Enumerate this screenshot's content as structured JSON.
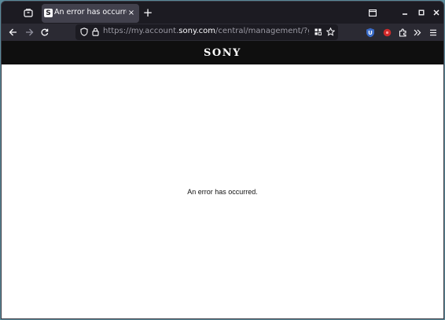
{
  "browser": {
    "tab": {
      "favicon": "S",
      "title": "An error has occurred."
    },
    "urlbar": {
      "scheme_prefix": "https://my.account.",
      "host": "sony.com",
      "path": "/central/management/?gated=t"
    }
  },
  "page": {
    "header": {
      "logo": "SONY"
    },
    "error_message": "An error has occurred."
  },
  "icons": {
    "tab_close": "×",
    "new_tab": "+"
  }
}
